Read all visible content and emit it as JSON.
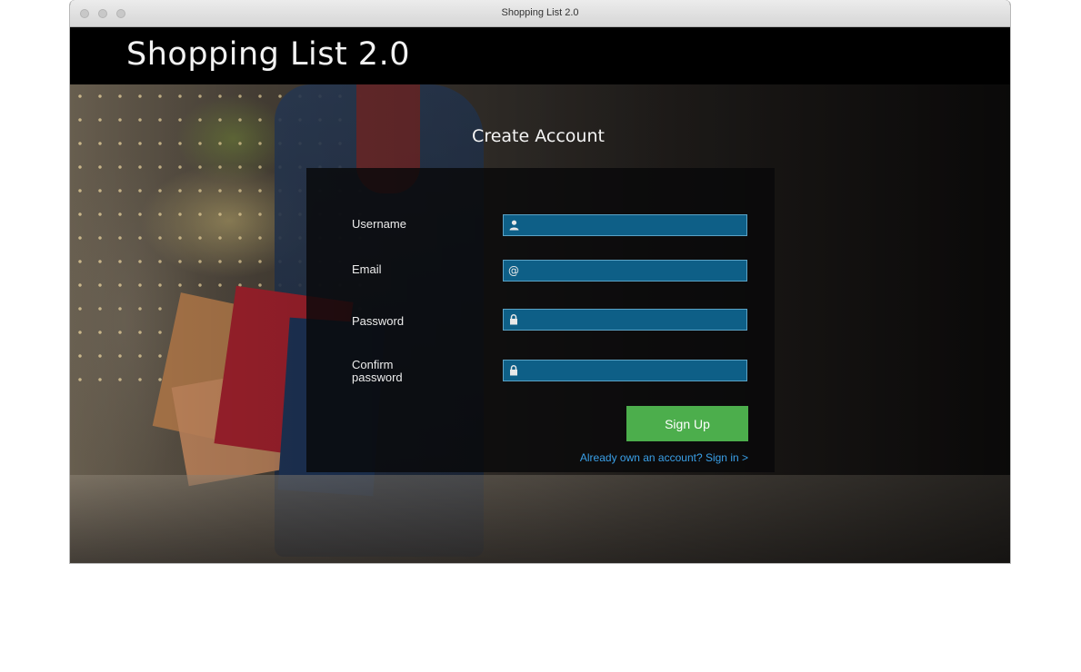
{
  "window": {
    "title": "Shopping List 2.0"
  },
  "header": {
    "app_title": "Shopping List 2.0"
  },
  "form": {
    "title": "Create Account",
    "fields": [
      {
        "label": "Username",
        "icon": "user-icon",
        "value": ""
      },
      {
        "label": "Email",
        "icon": "at-icon",
        "value": ""
      },
      {
        "label": "Password",
        "icon": "lock-icon",
        "value": ""
      },
      {
        "label": "Confirm password",
        "icon": "lock-icon",
        "value": ""
      }
    ],
    "signup_label": "Sign Up",
    "signin_link": "Already own an account? Sign in >"
  },
  "colors": {
    "field_bg": "#0e5f87",
    "button_bg": "#4cae4c",
    "link": "#3aa0e8",
    "header_bg": "#000000"
  }
}
